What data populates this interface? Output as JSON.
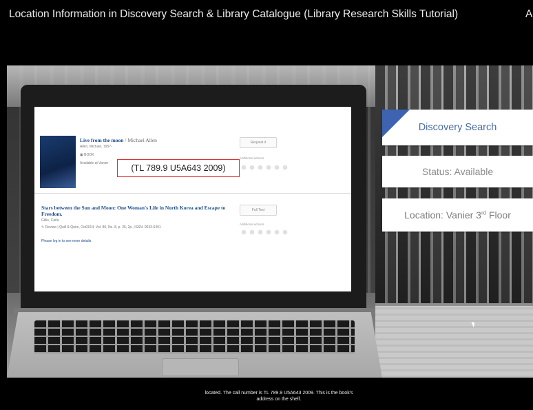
{
  "video": {
    "title": "Location Information in Discovery Search & Library Catalogue (Library Research Skills Tutorial)",
    "title_overflow": "A"
  },
  "results": [
    {
      "title": "Live from the moon",
      "author": " / Michael Allen",
      "creator": "Allen, Michael, 1957-",
      "format": "BOOK",
      "availability": "Available at Vanier",
      "action": "Request it",
      "actions_label": "Additional actions"
    },
    {
      "title": "Stars between the Sun and Moon: One Woman's Life in North Korea and Escape to Freedom.",
      "creator": "Gillis, Carla",
      "type": "Review",
      "citation": "Quill & Quire, Oct2014; Vol. 80, No. 8, p. 25, 2p., ISSN: 0033-6491",
      "login_note": "Please log in to see more details",
      "action": "Full Text",
      "actions_label": "Additional actions"
    }
  ],
  "callout": "(TL 789.9 U5A643 2009)",
  "panels": {
    "discovery": "Discovery Search",
    "status": "Status: Available",
    "location": "Location: Vanier 3rd Floor"
  },
  "caption": "located. The call number is TL 789.9 U5A643 2009. This is the book's address on the shelf.",
  "colors": {
    "accent": "#3e63b0",
    "callout_border": "#dd3333",
    "link": "#1c4a8a"
  }
}
